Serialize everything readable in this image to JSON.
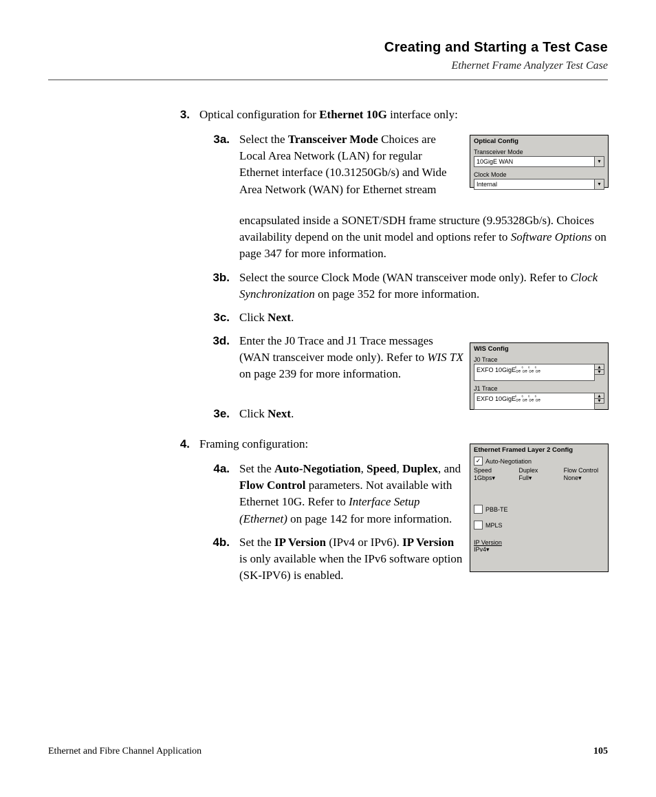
{
  "header": {
    "chapter": "Creating and Starting a Test Case",
    "section": "Ethernet Frame Analyzer Test Case"
  },
  "step3": {
    "marker": "3.",
    "text_pre": "Optical configuration for ",
    "text_bold": "Ethernet 10G",
    "text_post": " interface only:",
    "a": {
      "marker": "3a.",
      "text_parts": {
        "p1": "Select the ",
        "b1": "Transceiver Mode",
        "p2": " Choices are Local Area Network (LAN) for regular Ethernet interface (10.31250Gb/s) and Wide Area Network (WAN) for Ethernet stream encapsulated inside a SONET/SDH frame structure (9.95328Gb/s). Choices availability depend on the unit model and options refer to ",
        "i1": "Software Options",
        "p3": " on page 347 for more information."
      }
    },
    "b": {
      "marker": "3b.",
      "text_parts": {
        "p1": "Select the source Clock Mode (WAN transceiver mode only). Refer to ",
        "i1": "Clock Synchronization",
        "p2": " on page 352 for more information."
      }
    },
    "c": {
      "marker": "3c.",
      "text_parts": {
        "p1": "Click ",
        "b1": "Next",
        "p2": "."
      }
    },
    "d": {
      "marker": "3d.",
      "text_parts": {
        "p1": "Enter the J0 Trace and J1 Trace messages (WAN transceiver mode only). Refer to ",
        "i1": "WIS TX",
        "p2": " on page 239 for more information."
      }
    },
    "e": {
      "marker": "3e.",
      "text_parts": {
        "p1": "Click ",
        "b1": "Next",
        "p2": "."
      }
    }
  },
  "step4": {
    "marker": "4.",
    "text": "Framing configuration:",
    "a": {
      "marker": "4a.",
      "text_parts": {
        "p1": "Set the ",
        "b1": "Auto-Negotiation",
        "p2": ", ",
        "b2": "Speed",
        "p3": ", ",
        "b3": "Duplex",
        "p4": ", and ",
        "b4": "Flow Control",
        "p5": " parameters. Not available with Ethernet 10G. Refer to ",
        "i1": "Interface Setup (Ethernet)",
        "p6": " on page 142 for more information."
      }
    },
    "b": {
      "marker": "4b.",
      "text_parts": {
        "p1": "Set the ",
        "b1": "IP Version",
        "p2": " (IPv4 or IPv6). ",
        "b2": "IP Version",
        "p3": " is only available when the IPv6 software option (SK-IPV6) is enabled."
      }
    }
  },
  "panel_optical": {
    "title": "Optical Config",
    "label1": "Transceiver Mode",
    "value1": "10GigE WAN",
    "label2": "Clock Mode",
    "value2": "Internal"
  },
  "panel_wis": {
    "title": "WIS Config",
    "label1": "J0 Trace",
    "value1": "EXFO 10GigEⷠ₀ₑ ⷠ₀ₑ ⷠ₀ₑ ⷠ₀ₑ",
    "label2": "J1 Trace",
    "value2": "EXFO 10GigEⷠ₀ₑ ⷠ₀ₑ ⷠ₀ₑ ⷠ₀ₑ"
  },
  "panel_l2": {
    "title": "Ethernet Framed Layer 2 Config",
    "auto_neg_label": "Auto-Negotiation",
    "speed_label": "Speed",
    "speed_value": "1Gbps",
    "duplex_label": "Duplex",
    "duplex_value": "Full",
    "flow_label": "Flow Control",
    "flow_value": "None",
    "pbbte_label": "PBB-TE",
    "mpls_label": "MPLS",
    "ipver_label": "IP Version",
    "ipver_value": "IPv4"
  },
  "footer": {
    "left": "Ethernet and Fibre Channel Application",
    "page": "105"
  },
  "glyphs": {
    "down": "▾",
    "up": "▴",
    "check": "✓"
  }
}
